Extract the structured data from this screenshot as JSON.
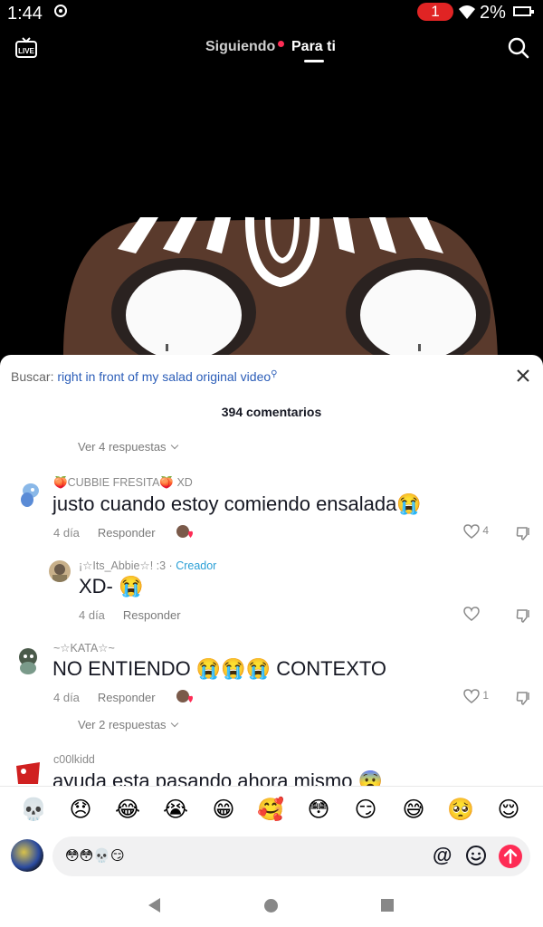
{
  "status_bar": {
    "time": "1:44",
    "notification_count": "1",
    "battery": "2%"
  },
  "top_nav": {
    "live_label": "LIVE",
    "tab_following": "Siguiendo",
    "tab_for_you": "Para ti"
  },
  "sheet": {
    "search_label": "Buscar:",
    "search_query": "right in front of my salad original video",
    "comment_count": "394 comentarios",
    "view_replies_top": "Ver 4 respuestas",
    "comments": [
      {
        "username": "🍑CUBBIE FRESITA🍑  XD",
        "text": "justo cuando estoy comiendo ensalada😭",
        "age": "4 día",
        "reply_label": "Responder",
        "likes": "4"
      },
      {
        "username": "¡☆Its_Abbie☆! :3 ·",
        "creator_badge": "Creador",
        "text": "XD- 😭",
        "age": "4 día",
        "reply_label": "Responder",
        "likes": ""
      },
      {
        "username": "~☆KATA☆~",
        "text": "NO ENTIENDO 😭😭😭 CONTEXTO",
        "age": "4 día",
        "reply_label": "Responder",
        "likes": "1",
        "view_replies": "Ver 2 respuestas"
      },
      {
        "username": "c00lkidd",
        "text": "ayuda esta pasando ahora mismo 😨"
      }
    ]
  },
  "emoji_bar": [
    "💀",
    "😞",
    "😂",
    "😭",
    "😁",
    "🥰",
    "😳",
    "😏",
    "😅",
    "🥺",
    "😌"
  ],
  "input": {
    "value": "😳😳💀😏",
    "at_symbol": "@"
  },
  "colors": {
    "accent": "#fe2c55",
    "link": "#2b5db8",
    "creator": "#2a9fd6"
  }
}
